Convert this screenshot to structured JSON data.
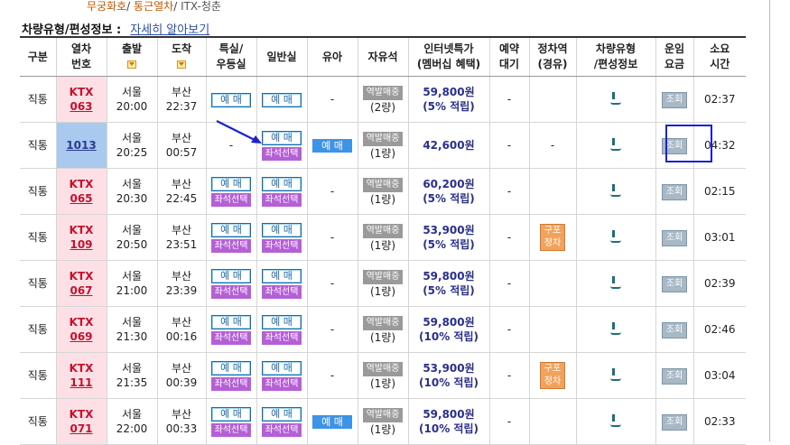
{
  "top_links": [
    "무궁화호",
    "통근열차",
    "ITX-청춘"
  ],
  "info": {
    "title": "차량유형/편성정보 :",
    "link": "자세히 알아보기"
  },
  "headers": {
    "gubun": "구분",
    "train": [
      "열차",
      "번호"
    ],
    "dep": "출발",
    "arr": "도착",
    "special": [
      "특실/",
      "우등실"
    ],
    "general": "일반실",
    "infant": "유아",
    "free": "자유석",
    "internet": [
      "인터넷특가",
      "(멤버십 혜택)"
    ],
    "wait": [
      "예약",
      "대기"
    ],
    "transfer": [
      "정차역",
      "(경유)"
    ],
    "vehicle": [
      "차량유형",
      "/편성정보"
    ],
    "fare": [
      "운임",
      "요금"
    ],
    "duration": [
      "소요",
      "시간"
    ]
  },
  "labels": {
    "reserve": "예 매",
    "seat_select": "좌석선택",
    "standing": "역발매중",
    "view": "조회",
    "dash": "-",
    "transfer_stop": [
      "구포",
      "정차"
    ]
  },
  "rows": [
    {
      "type": "직통",
      "train_name": "KTX",
      "train_no": "063",
      "dep_station": "서울",
      "dep_time": "20:00",
      "arr_station": "부산",
      "arr_time": "22:37",
      "special": "reserve",
      "general": "reserve",
      "infant": "-",
      "free_cars": "(2량)",
      "price": "59,800원",
      "points": "(5% 적립)",
      "wait": "-",
      "transfer": "",
      "duration": "02:37"
    },
    {
      "type": "직통",
      "train_name": "",
      "train_no": "1013",
      "dep_station": "서울",
      "dep_time": "20:25",
      "arr_station": "부산",
      "arr_time": "00:57",
      "special": "-",
      "general": "reserve_seat",
      "infant": "reserve",
      "free_cars": "(1량)",
      "price": "42,600원",
      "points": "",
      "wait": "-",
      "transfer": "-",
      "duration": "04:32"
    },
    {
      "type": "직통",
      "train_name": "KTX",
      "train_no": "065",
      "dep_station": "서울",
      "dep_time": "20:30",
      "arr_station": "부산",
      "arr_time": "22:45",
      "special": "reserve_seat",
      "general": "reserve_seat",
      "infant": "-",
      "free_cars": "(1량)",
      "price": "60,200원",
      "points": "(5% 적립)",
      "wait": "-",
      "transfer": "",
      "duration": "02:15"
    },
    {
      "type": "직통",
      "train_name": "KTX",
      "train_no": "109",
      "dep_station": "서울",
      "dep_time": "20:50",
      "arr_station": "부산",
      "arr_time": "23:51",
      "special": "reserve_seat",
      "general": "reserve_seat",
      "infant": "-",
      "free_cars": "(1량)",
      "price": "53,900원",
      "points": "(5% 적립)",
      "wait": "-",
      "transfer": "구포정차",
      "duration": "03:01"
    },
    {
      "type": "직통",
      "train_name": "KTX",
      "train_no": "067",
      "dep_station": "서울",
      "dep_time": "21:00",
      "arr_station": "부산",
      "arr_time": "23:39",
      "special": "reserve_seat",
      "general": "reserve_seat",
      "infant": "-",
      "free_cars": "(1량)",
      "price": "59,800원",
      "points": "(5% 적립)",
      "wait": "-",
      "transfer": "",
      "duration": "02:39"
    },
    {
      "type": "직통",
      "train_name": "KTX",
      "train_no": "069",
      "dep_station": "서울",
      "dep_time": "21:30",
      "arr_station": "부산",
      "arr_time": "00:16",
      "special": "reserve_seat",
      "general": "reserve_seat",
      "infant": "-",
      "free_cars": "(1량)",
      "price": "59,800원",
      "points": "(10% 적립)",
      "wait": "-",
      "transfer": "",
      "duration": "02:46"
    },
    {
      "type": "직통",
      "train_name": "KTX",
      "train_no": "111",
      "dep_station": "서울",
      "dep_time": "21:35",
      "arr_station": "부산",
      "arr_time": "00:39",
      "special": "reserve_seat",
      "general": "reserve_seat",
      "infant": "-",
      "free_cars": "(1량)",
      "price": "53,900원",
      "points": "(10% 적립)",
      "wait": "-",
      "transfer": "구포정차",
      "duration": "03:04"
    },
    {
      "type": "직통",
      "train_name": "KTX",
      "train_no": "071",
      "dep_station": "서울",
      "dep_time": "22:00",
      "arr_station": "부산",
      "arr_time": "00:33",
      "special": "reserve_seat",
      "general": "reserve_seat",
      "infant": "reserve",
      "free_cars": "(1량)",
      "price": "59,800원",
      "points": "(10% 적립)",
      "wait": "-",
      "transfer": "",
      "duration": "02:33"
    }
  ]
}
